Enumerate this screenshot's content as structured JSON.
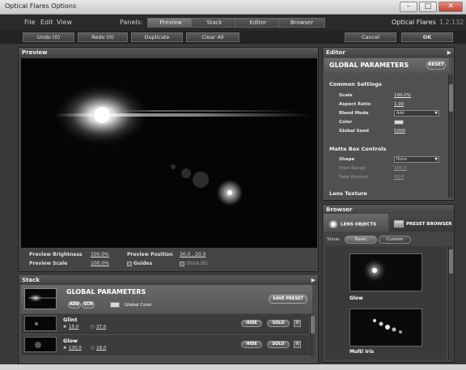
{
  "window": {
    "title": "Optical Flares Options"
  },
  "menu": {
    "file": "File",
    "edit": "Edit",
    "view": "View",
    "panels_label": "Panels:"
  },
  "tabs": [
    "Preview",
    "Stack",
    "Editor",
    "Browser"
  ],
  "brand": {
    "name": "Optical Flares",
    "version": "1.2.132"
  },
  "toolbar": {
    "undo": "Undo (0)",
    "redo": "Redo (0)",
    "duplicate": "Duplicate",
    "clear_all": "Clear All",
    "cancel": "Cancel",
    "ok": "OK"
  },
  "preview": {
    "title": "Preview",
    "brightness_label": "Preview Brightness",
    "brightness_value": "100.0%",
    "scale_label": "Preview Scale",
    "scale_value": "100.0%",
    "position_label": "Preview Position",
    "position_value": "30.0 , 20.0",
    "guides_label": "Guides",
    "show_bg_label": "Show BG"
  },
  "editor": {
    "title": "Editor",
    "header": "GLOBAL PARAMETERS",
    "reset": "RESET",
    "common_section": "Common Settings",
    "scale_label": "Scale",
    "scale_value": "100.0%",
    "aspect_label": "Aspect Ratio",
    "aspect_value": "1.00",
    "blend_label": "Blend Mode",
    "blend_value": "Add",
    "color_label": "Color",
    "seed_label": "Global Seed",
    "seed_value": "5000",
    "matte_section": "Matte Box Controls",
    "shape_label": "Shape",
    "shape_value": "None",
    "start_label": "Start Range",
    "start_value": "100.0",
    "fade_label": "Fade Amount",
    "fade_value": "50.0",
    "texture_section": "Lens Texture"
  },
  "browser": {
    "title": "Browser",
    "lens_objects": "LENS OBJECTS",
    "preset_browser": "PRESET BROWSER",
    "show_label": "Show:",
    "basic": "Basic",
    "custom": "Custom",
    "items": [
      "Glow",
      "Multi Iris"
    ]
  },
  "stack": {
    "title": "Stack",
    "gp_title": "GLOBAL PARAMETERS",
    "add": "ADD",
    "scn": "SCN",
    "global_color": "Global Color",
    "save_preset": "SAVE PRESET",
    "hide": "HIDE",
    "solo": "SOLO",
    "delete": "X",
    "layers": [
      {
        "name": "Glint",
        "brightness": "15.0",
        "scale": "37.0"
      },
      {
        "name": "Glow",
        "brightness": "130.0",
        "scale": "18.0"
      }
    ]
  },
  "colors": {
    "panel": "#444444",
    "accent": "#d8d8d8"
  }
}
